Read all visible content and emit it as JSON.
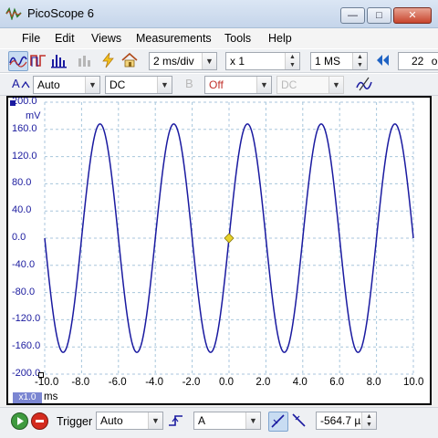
{
  "window": {
    "title": "PicoScope 6",
    "minimize_glyph": "—",
    "maximize_glyph": "□",
    "close_glyph": "✕"
  },
  "menu": {
    "items": [
      "File",
      "Edit",
      "Views",
      "Measurements",
      "Tools",
      "Help"
    ]
  },
  "toolbar": {
    "scope_mode_icon": "scope-mode-icon",
    "persistence_mode_icon": "persistence-mode-icon",
    "spectrum_mode_icon": "spectrum-mode-icon",
    "collection_time": "2 ms/div",
    "zoom_factor": "x 1",
    "samples": "1 MS",
    "capture_count": "22",
    "capture_count_suffix": "o"
  },
  "channels": {
    "a_label": "A",
    "a_range": "Auto",
    "a_coupling": "DC",
    "b_label": "B",
    "b_range": "Off",
    "b_coupling": "DC"
  },
  "plot": {
    "y_unit": "mV",
    "x_unit": "ms",
    "zoom_badge": "x1.0",
    "trace_color": "#1a1aa0",
    "grid_color": "#a8c6dc",
    "trigger_marker_color": "#e8d22a"
  },
  "chart_data": {
    "type": "line",
    "title": "",
    "xlabel": "ms",
    "ylabel": "mV",
    "xlim": [
      -10.0,
      10.0
    ],
    "ylim": [
      -200.0,
      200.0
    ],
    "x_ticks": [
      "-10.0",
      "-8.0",
      "-6.0",
      "-4.0",
      "-2.0",
      "0.0",
      "2.0",
      "4.0",
      "6.0",
      "8.0",
      "10.0"
    ],
    "y_ticks": [
      "200.0",
      "160.0",
      "120.0",
      "80.0",
      "40.0",
      "0.0",
      "-40.0",
      "-80.0",
      "-120.0",
      "-160.0",
      "-200.0"
    ],
    "grid": true,
    "series": [
      {
        "color": "#1a1aa0",
        "waveform": "sine",
        "amplitude_mV": 168,
        "frequency_kHz": 0.25,
        "phase_at_zero": "rising zero crossing",
        "x_range": [
          -10.0,
          10.0
        ]
      }
    ],
    "trigger_marker": {
      "x": 0.0,
      "y": 0.0
    }
  },
  "statusbar": {
    "trigger_label": "Trigger",
    "trigger_mode": "Auto",
    "trigger_source": "A",
    "pre_trigger": "-564.7 µ"
  }
}
